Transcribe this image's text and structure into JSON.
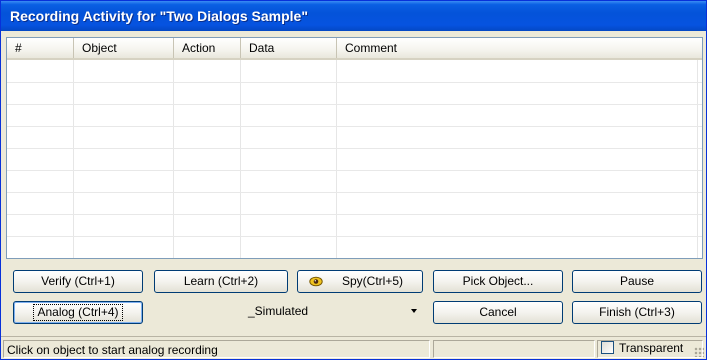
{
  "window": {
    "title": "Recording Activity for \"Two Dialogs Sample\""
  },
  "grid": {
    "columns": [
      "#",
      "Object",
      "Action",
      "Data",
      "Comment"
    ],
    "rows": []
  },
  "buttons": {
    "verify": "Verify (Ctrl+1)",
    "learn": "Learn (Ctrl+2)",
    "spy": "Spy(Ctrl+5)",
    "pick_object": "Pick Object...",
    "pause": "Pause",
    "analog": "Analog (Ctrl+4)",
    "cancel": "Cancel",
    "finish": "Finish (Ctrl+3)"
  },
  "mode_select": {
    "selected": "_Simulated"
  },
  "statusbar": {
    "message": "Click on object to start analog recording",
    "transparent_label": "Transparent",
    "transparent_checked": false
  },
  "colors": {
    "titlebar": "#0453d9",
    "face": "#ece9d8",
    "button_border": "#003c74"
  },
  "icons": {
    "spy": "eye-icon",
    "dropdown": "chevron-down-icon"
  }
}
